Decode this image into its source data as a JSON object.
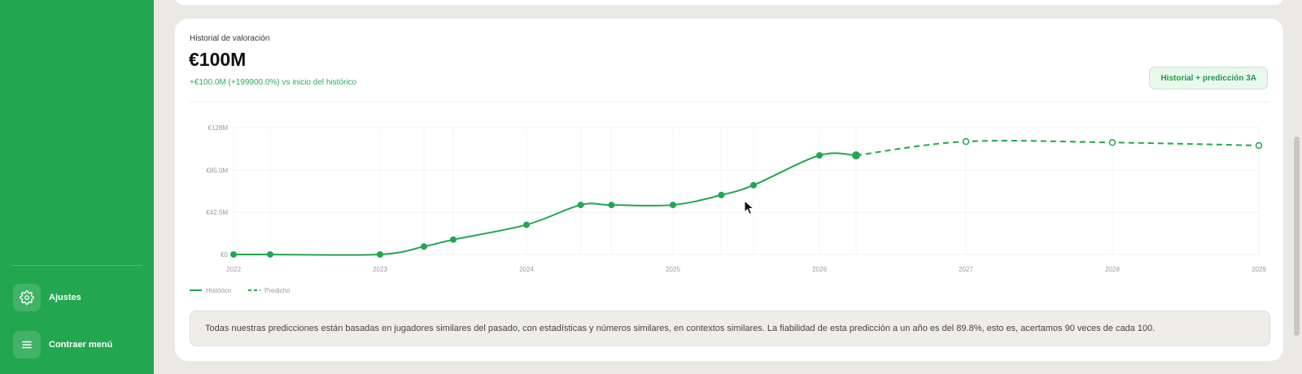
{
  "sidebar": {
    "items": [
      {
        "label": "Ajustes",
        "icon": "gear-icon"
      },
      {
        "label": "Contraer menú",
        "icon": "menu-icon"
      }
    ],
    "colors": {
      "background": "#22a650"
    }
  },
  "card": {
    "title": "Historial de valoración",
    "value": "€100M",
    "change": "+€100.0M (+199900.0%) vs inicio del histórico",
    "badge": "Historial + predicción 3A",
    "note": "Todas nuestras predicciones están basadas en jugadores similares del pasado, con estadísticas y números similares, en contextos similares. La fiabilidad de esta predicción a un año es del 89.8%, esto es, acertamos 90 veces de cada 100."
  },
  "chart_data": {
    "type": "line",
    "ylim": [
      0,
      128
    ],
    "y_unit": "€M",
    "y_ticks": [
      "€128M",
      "€85.0M",
      "€42.5M",
      "€0"
    ],
    "y_tick_values": [
      128,
      85,
      42.5,
      0
    ],
    "x_ticks": [
      "2022",
      "2023",
      "2024",
      "2025",
      "2026",
      "2027",
      "2028",
      "2029"
    ],
    "x_tick_values": [
      2022.0,
      2023.0,
      2024.0,
      2025.0,
      2026.0,
      2027.0,
      2028.0,
      2029.0
    ],
    "grid": true,
    "legend_position": "bottom-left",
    "color": "#22a650",
    "series": [
      {
        "name": "Histórico",
        "style": "solid",
        "x": [
          2022.0,
          2022.25,
          2023.0,
          2023.3,
          2023.5,
          2024.0,
          2024.37,
          2024.58,
          2025.0,
          2025.33,
          2025.55,
          2026.0,
          2026.25
        ],
        "values": [
          0.05,
          0.05,
          0.05,
          8,
          15,
          30,
          50,
          50,
          50,
          60,
          70,
          100,
          100
        ]
      },
      {
        "name": "Predicho",
        "style": "dashed",
        "x": [
          2026.25,
          2027.0,
          2028.0,
          2029.0
        ],
        "values": [
          100,
          114,
          113,
          110
        ]
      }
    ]
  }
}
